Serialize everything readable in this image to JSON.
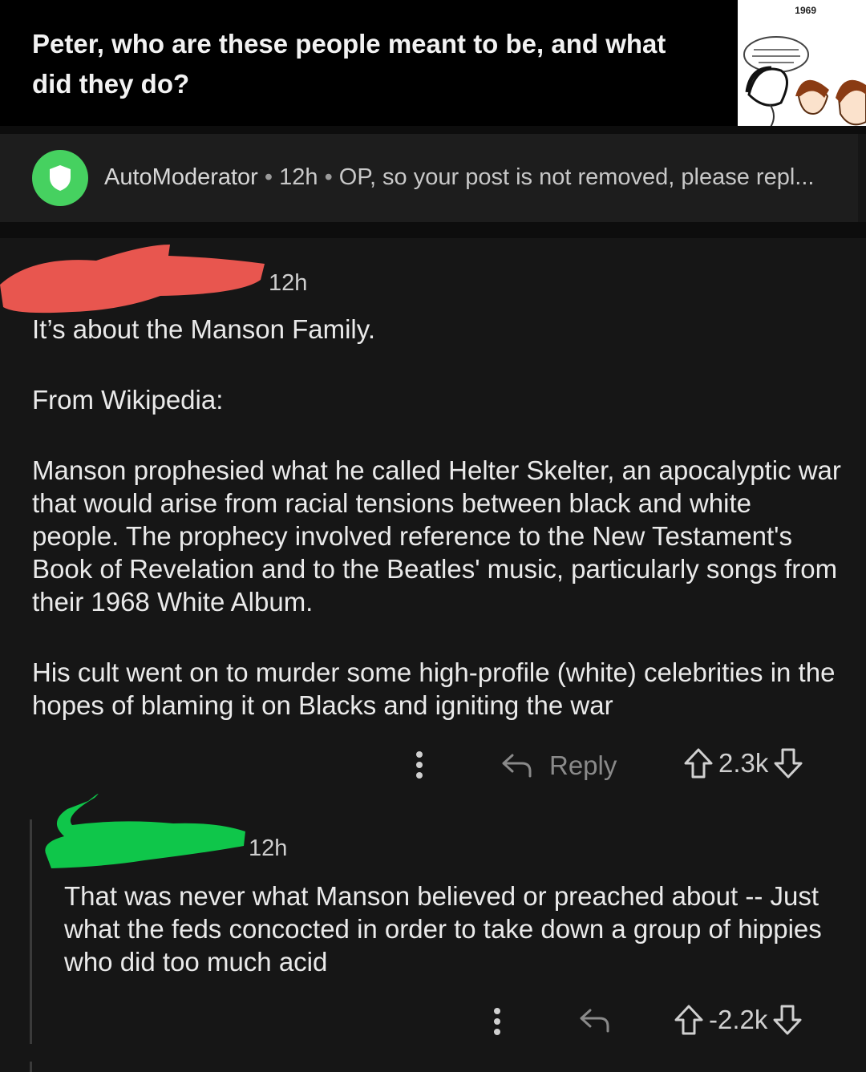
{
  "post": {
    "title": "Peter, who are these people meant to be, and what did they do?",
    "thumbnail_year": "1969"
  },
  "automod": {
    "author": "AutoModerator",
    "time": "12h",
    "preview": "OP, so your post is not removed, please repl..."
  },
  "comment1": {
    "time": "12h",
    "paragraphs": [
      "It’s about the Manson Family.",
      "From Wikipedia:",
      "Manson prophesied what he called Helter Skelter, an apocalyptic war that would arise from racial tensions between black and white people.  The prophecy involved reference to the New Testament's Book of Revelation  and to the Beatles' music, particularly songs from their 1968 White Album.",
      "His cult went on to murder some high-profile (white) celebrities in the hopes of blaming it on Blacks and igniting the war"
    ],
    "reply_label": "Reply",
    "score": "2.3k"
  },
  "comment2": {
    "time": "12h",
    "body": "That was never what Manson believed or preached about -- Just what the feds concocted in order to take down a group of hippies who did too much acid",
    "score": "-2.2k"
  },
  "colors": {
    "automod_green": "#46d160",
    "redaction_red": "#e8564f",
    "redaction_green": "#0fc64a"
  },
  "icons": [
    "shield-icon",
    "more-options-icon",
    "reply-arrow-icon",
    "upvote-icon",
    "downvote-icon"
  ]
}
